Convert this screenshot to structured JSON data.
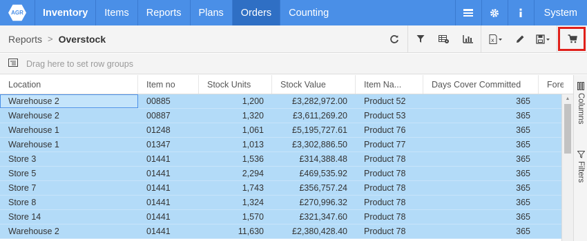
{
  "nav": {
    "logo_text": "AGR",
    "brand": "Inventory",
    "items": [
      "Items",
      "Reports",
      "Plans",
      "Orders",
      "Counting"
    ],
    "active": "Orders",
    "system_label": "System",
    "icons": [
      "panel-icon",
      "gear-icon",
      "info-icon"
    ]
  },
  "breadcrumb": {
    "parent": "Reports",
    "separator": ">",
    "current": "Overstock"
  },
  "toolbar": {
    "icons": [
      "refresh-icon",
      "filter-icon",
      "table-settings-icon",
      "chart-icon",
      "excel-export-icon",
      "edit-icon",
      "save-icon",
      "cart-icon"
    ],
    "highlighted": "cart-icon"
  },
  "group_panel": {
    "hint": "Drag here to set row groups"
  },
  "grid": {
    "columns": [
      "Location",
      "Item no",
      "Stock Units",
      "Stock Value",
      "Item Na...",
      "Days Cover Committed",
      "Foreca"
    ],
    "rows": [
      [
        "Warehouse 2",
        "00885",
        "1,200",
        "£3,282,972.00",
        "Product 52",
        "365"
      ],
      [
        "Warehouse 2",
        "00887",
        "1,320",
        "£3,611,269.20",
        "Product 53",
        "365"
      ],
      [
        "Warehouse 1",
        "01248",
        "1,061",
        "£5,195,727.61",
        "Product 76",
        "365"
      ],
      [
        "Warehouse 1",
        "01347",
        "1,013",
        "£3,302,886.50",
        "Product 77",
        "365"
      ],
      [
        "Store 3",
        "01441",
        "1,536",
        "£314,388.48",
        "Product 78",
        "365"
      ],
      [
        "Store 5",
        "01441",
        "2,294",
        "£469,535.92",
        "Product 78",
        "365"
      ],
      [
        "Store 7",
        "01441",
        "1,743",
        "£356,757.24",
        "Product 78",
        "365"
      ],
      [
        "Store 8",
        "01441",
        "1,324",
        "£270,996.32",
        "Product 78",
        "365"
      ],
      [
        "Store 14",
        "01441",
        "1,570",
        "£321,347.60",
        "Product 78",
        "365"
      ],
      [
        "Warehouse 2",
        "01441",
        "11,630",
        "£2,380,428.40",
        "Product 78",
        "365"
      ]
    ]
  },
  "side_panel": {
    "columns_label": "Columns",
    "filters_label": "Filters"
  },
  "colors": {
    "nav_bg": "#4a8fe7",
    "nav_active": "#2f6fc4",
    "row_selected": "#b3dbf8",
    "highlight_border": "#e0201a"
  }
}
